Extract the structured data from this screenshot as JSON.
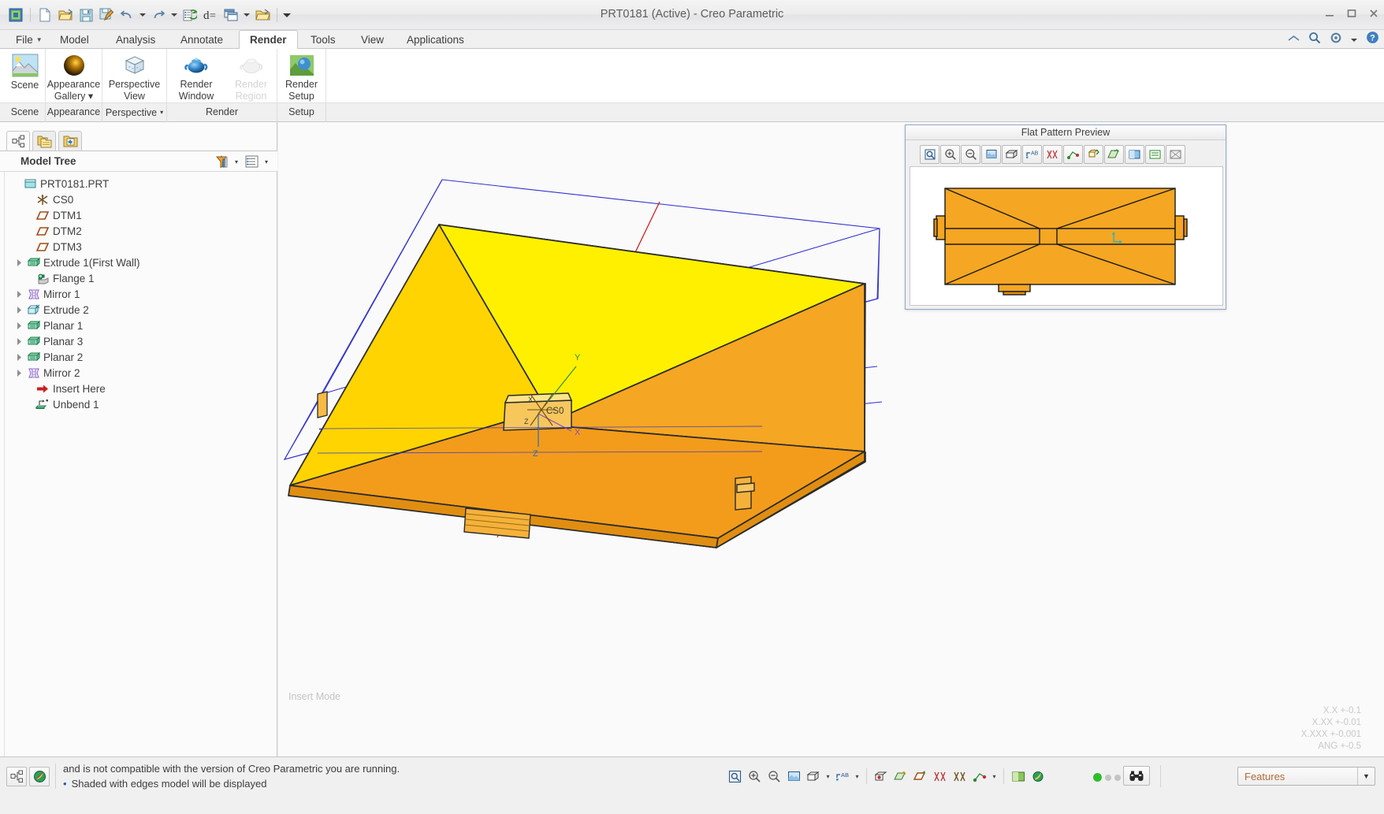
{
  "window": {
    "title": "PRT0181 (Active) - Creo Parametric",
    "minimize_label": "Minimize",
    "maximize_label": "Restore",
    "close_label": "Close"
  },
  "quick_access": {
    "items": [
      {
        "name": "creo-window-icon",
        "label": "Creo Window"
      },
      {
        "name": "new-icon",
        "label": "New"
      },
      {
        "name": "open-icon",
        "label": "Open"
      },
      {
        "name": "save-icon",
        "label": "Save"
      },
      {
        "name": "save-as-icon",
        "label": "Save a Copy"
      },
      {
        "name": "undo-icon",
        "label": "Undo"
      },
      {
        "name": "redo-icon",
        "label": "Redo"
      },
      {
        "name": "regenerate-icon",
        "label": "Regenerate"
      },
      {
        "name": "relations-icon",
        "label": "Relations"
      },
      {
        "name": "window-icon",
        "label": "Window"
      },
      {
        "name": "close-window-icon",
        "label": "Close"
      },
      {
        "name": "qat-overflow-icon",
        "label": "Customize Quick Access Toolbar"
      }
    ]
  },
  "tabs": [
    {
      "label": "File",
      "has_caret": true,
      "active": false
    },
    {
      "label": "Model",
      "has_caret": false,
      "active": false
    },
    {
      "label": "Analysis",
      "has_caret": false,
      "active": false
    },
    {
      "label": "Annotate",
      "has_caret": false,
      "active": false
    },
    {
      "label": "Render",
      "has_caret": false,
      "active": true
    },
    {
      "label": "Tools",
      "has_caret": false,
      "active": false
    },
    {
      "label": "View",
      "has_caret": false,
      "active": false
    },
    {
      "label": "Applications",
      "has_caret": false,
      "active": false
    }
  ],
  "help_cluster": [
    {
      "name": "minimize-ribbon-icon",
      "label": "Minimize the Ribbon"
    },
    {
      "name": "search-icon",
      "label": "Search"
    },
    {
      "name": "settings-gear-icon",
      "label": "Settings"
    },
    {
      "name": "settings-caret-icon",
      "label": "Settings menu"
    },
    {
      "name": "help-icon",
      "label": "Help"
    }
  ],
  "ribbon": {
    "buttons": [
      {
        "name": "scene-button",
        "icon": "scene-icon",
        "line1": "Scene",
        "line2": "",
        "caret": false,
        "disabled": false
      },
      {
        "name": "appearance-gallery-button",
        "icon": "appearance-sphere-icon",
        "line1": "Appearance",
        "line2": "Gallery",
        "caret": true,
        "disabled": false
      },
      {
        "name": "perspective-view-button",
        "icon": "perspective-cube-icon",
        "line1": "Perspective",
        "line2": "View",
        "caret": false,
        "disabled": false
      },
      {
        "name": "render-window-button",
        "icon": "blue-teapot-icon",
        "line1": "Render",
        "line2": "Window",
        "caret": false,
        "disabled": false
      },
      {
        "name": "render-region-button",
        "icon": "grey-teapot-icon",
        "line1": "Render",
        "line2": "Region",
        "caret": false,
        "disabled": true
      },
      {
        "name": "render-setup-button",
        "icon": "render-setup-icon",
        "line1": "Render",
        "line2": "Setup",
        "caret": false,
        "disabled": false
      }
    ],
    "groups": [
      {
        "name": "group-scene",
        "label": "Scene",
        "caret": false
      },
      {
        "name": "group-appearance",
        "label": "Appearance",
        "caret": false
      },
      {
        "name": "group-perspective",
        "label": "Perspective",
        "caret": true
      },
      {
        "name": "group-render",
        "label": "Render",
        "caret": false
      },
      {
        "name": "group-setup",
        "label": "Setup",
        "caret": false
      }
    ]
  },
  "navigator": {
    "tabs": [
      {
        "name": "model-tree-tab",
        "icon": "tree-icon",
        "active": true
      },
      {
        "name": "folder-browser-tab",
        "icon": "folders-icon",
        "active": false
      },
      {
        "name": "favorites-tab",
        "icon": "favorites-folder-icon",
        "active": false
      }
    ],
    "header": {
      "title": "Model Tree",
      "tools": [
        {
          "name": "tree-filters-icon",
          "label": "Filters"
        },
        {
          "name": "tree-filters-caret-icon",
          "label": "Filters menu"
        },
        {
          "name": "tree-settings-icon",
          "label": "Settings"
        },
        {
          "name": "tree-settings-caret-icon",
          "label": "Settings menu"
        }
      ]
    },
    "tree": [
      {
        "label": "PRT0181.PRT",
        "indent": 0,
        "expander": "none",
        "icon": "part-icon"
      },
      {
        "label": "CS0",
        "indent": 1,
        "expander": "none",
        "icon": "coord-system-icon"
      },
      {
        "label": "DTM1",
        "indent": 1,
        "expander": "none",
        "icon": "datum-plane-icon"
      },
      {
        "label": "DTM2",
        "indent": 1,
        "expander": "none",
        "icon": "datum-plane-icon"
      },
      {
        "label": "DTM3",
        "indent": 1,
        "expander": "none",
        "icon": "datum-plane-icon"
      },
      {
        "label": "Extrude 1(First Wall)",
        "indent": 1,
        "expander": "collapsed",
        "icon": "first-wall-icon"
      },
      {
        "label": "Flange 1",
        "indent": 1,
        "expander": "none",
        "icon": "flange-icon"
      },
      {
        "label": "Mirror 1",
        "indent": 1,
        "expander": "collapsed",
        "icon": "mirror-icon"
      },
      {
        "label": "Extrude 2",
        "indent": 1,
        "expander": "collapsed",
        "icon": "extrude-cut-icon"
      },
      {
        "label": "Planar 1",
        "indent": 1,
        "expander": "collapsed",
        "icon": "planar-wall-icon"
      },
      {
        "label": "Planar 3",
        "indent": 1,
        "expander": "collapsed",
        "icon": "planar-wall-icon"
      },
      {
        "label": "Planar 2",
        "indent": 1,
        "expander": "collapsed",
        "icon": "planar-wall-icon"
      },
      {
        "label": "Mirror 2",
        "indent": 1,
        "expander": "collapsed",
        "icon": "mirror-icon"
      },
      {
        "label": "Insert Here",
        "indent": 1,
        "expander": "none",
        "icon": "insert-here-icon"
      },
      {
        "label": "Unbend 1",
        "indent": 1,
        "expander": "none",
        "icon": "unbend-icon"
      }
    ]
  },
  "graphics": {
    "insert_mode_label": "Insert Mode",
    "tolerances": [
      "X.X +-0.1",
      "X.XX +-0.01",
      "X.XXX +-0.001",
      "ANG +-0.5"
    ],
    "model": {
      "name": "sheet-metal-part",
      "body_colors": {
        "top": "#ffe200",
        "side": "#f5a623",
        "edge": "#2a2a2a"
      },
      "datum_outline_color": "#3333cc",
      "axis_color": "#cc2222",
      "csys_label": "CS0",
      "csys_axes": [
        "X",
        "Y",
        "Z"
      ]
    }
  },
  "flat_pattern_preview": {
    "title": "Flat Pattern Preview",
    "toolbar": [
      {
        "name": "refit-icon",
        "label": "Refit"
      },
      {
        "name": "zoom-in-icon",
        "label": "Zoom In"
      },
      {
        "name": "zoom-out-icon",
        "label": "Zoom Out"
      },
      {
        "name": "repaint-icon",
        "label": "Repaint"
      },
      {
        "name": "saved-views-icon",
        "label": "Saved Orientations"
      },
      {
        "name": "annotations-display-icon",
        "label": "Annotation Display"
      },
      {
        "name": "axis-display-icon",
        "label": "Axis Display"
      },
      {
        "name": "point-display-icon",
        "label": "Point Display"
      },
      {
        "name": "csys-display-icon",
        "label": "Csys Display"
      },
      {
        "name": "plane-display-icon",
        "label": "Plane Display"
      },
      {
        "name": "shading-icon",
        "label": "Shading"
      },
      {
        "name": "hidden-line-icon",
        "label": "Hidden Line"
      },
      {
        "name": "wireframe-icon",
        "label": "Wireframe"
      }
    ],
    "drawing": {
      "name": "flat-pattern-drawing",
      "fill_color": "#f5a623",
      "line_color": "#1a1a1a"
    }
  },
  "message_area": {
    "icons": [
      {
        "name": "model-tree-toggle-icon",
        "label": "Model Tree"
      },
      {
        "name": "browser-toggle-icon",
        "label": "Web Browser"
      }
    ],
    "lines": [
      {
        "bullet": false,
        "text": "and is not compatible with the version of Creo Parametric you are running."
      },
      {
        "bullet": true,
        "text": "Shaded with edges model will be displayed"
      }
    ]
  },
  "bottom_toolbar": {
    "items": [
      {
        "name": "refit-icon",
        "label": "Refit",
        "caret": false
      },
      {
        "name": "zoom-in-icon",
        "label": "Zoom In",
        "caret": false
      },
      {
        "name": "zoom-out-icon",
        "label": "Zoom Out",
        "caret": false
      },
      {
        "name": "repaint-icon",
        "label": "Repaint",
        "caret": false
      },
      {
        "name": "saved-views-icon",
        "label": "Saved Orientations",
        "caret": true
      },
      {
        "name": "annotation-display-icon",
        "label": "Annotation Display",
        "caret": true
      },
      {
        "name": "spin-center-icon",
        "label": "Spin Center",
        "caret": false
      },
      {
        "name": "datum-display-icon",
        "label": "Datum Display Filters",
        "caret": false
      },
      {
        "name": "plane-display-icon",
        "label": "Plane Display",
        "caret": false
      },
      {
        "name": "axis-display-icon",
        "label": "Axis Display",
        "caret": false
      },
      {
        "name": "point-display-icon",
        "label": "Point Display",
        "caret": false
      },
      {
        "name": "csys-display-icon",
        "label": "Csys Display",
        "caret": true
      },
      {
        "name": "display-style-icon",
        "label": "Display Style",
        "caret": false
      },
      {
        "name": "appearance-icon",
        "label": "Appearance",
        "caret": false
      }
    ],
    "leds": [
      "#2bbf2b",
      "#c4c4c4",
      "#c4c4c4"
    ],
    "search_icon": {
      "name": "find-icon",
      "label": "Find"
    },
    "filter_select": {
      "name": "selection-filter",
      "value": "Features"
    }
  }
}
